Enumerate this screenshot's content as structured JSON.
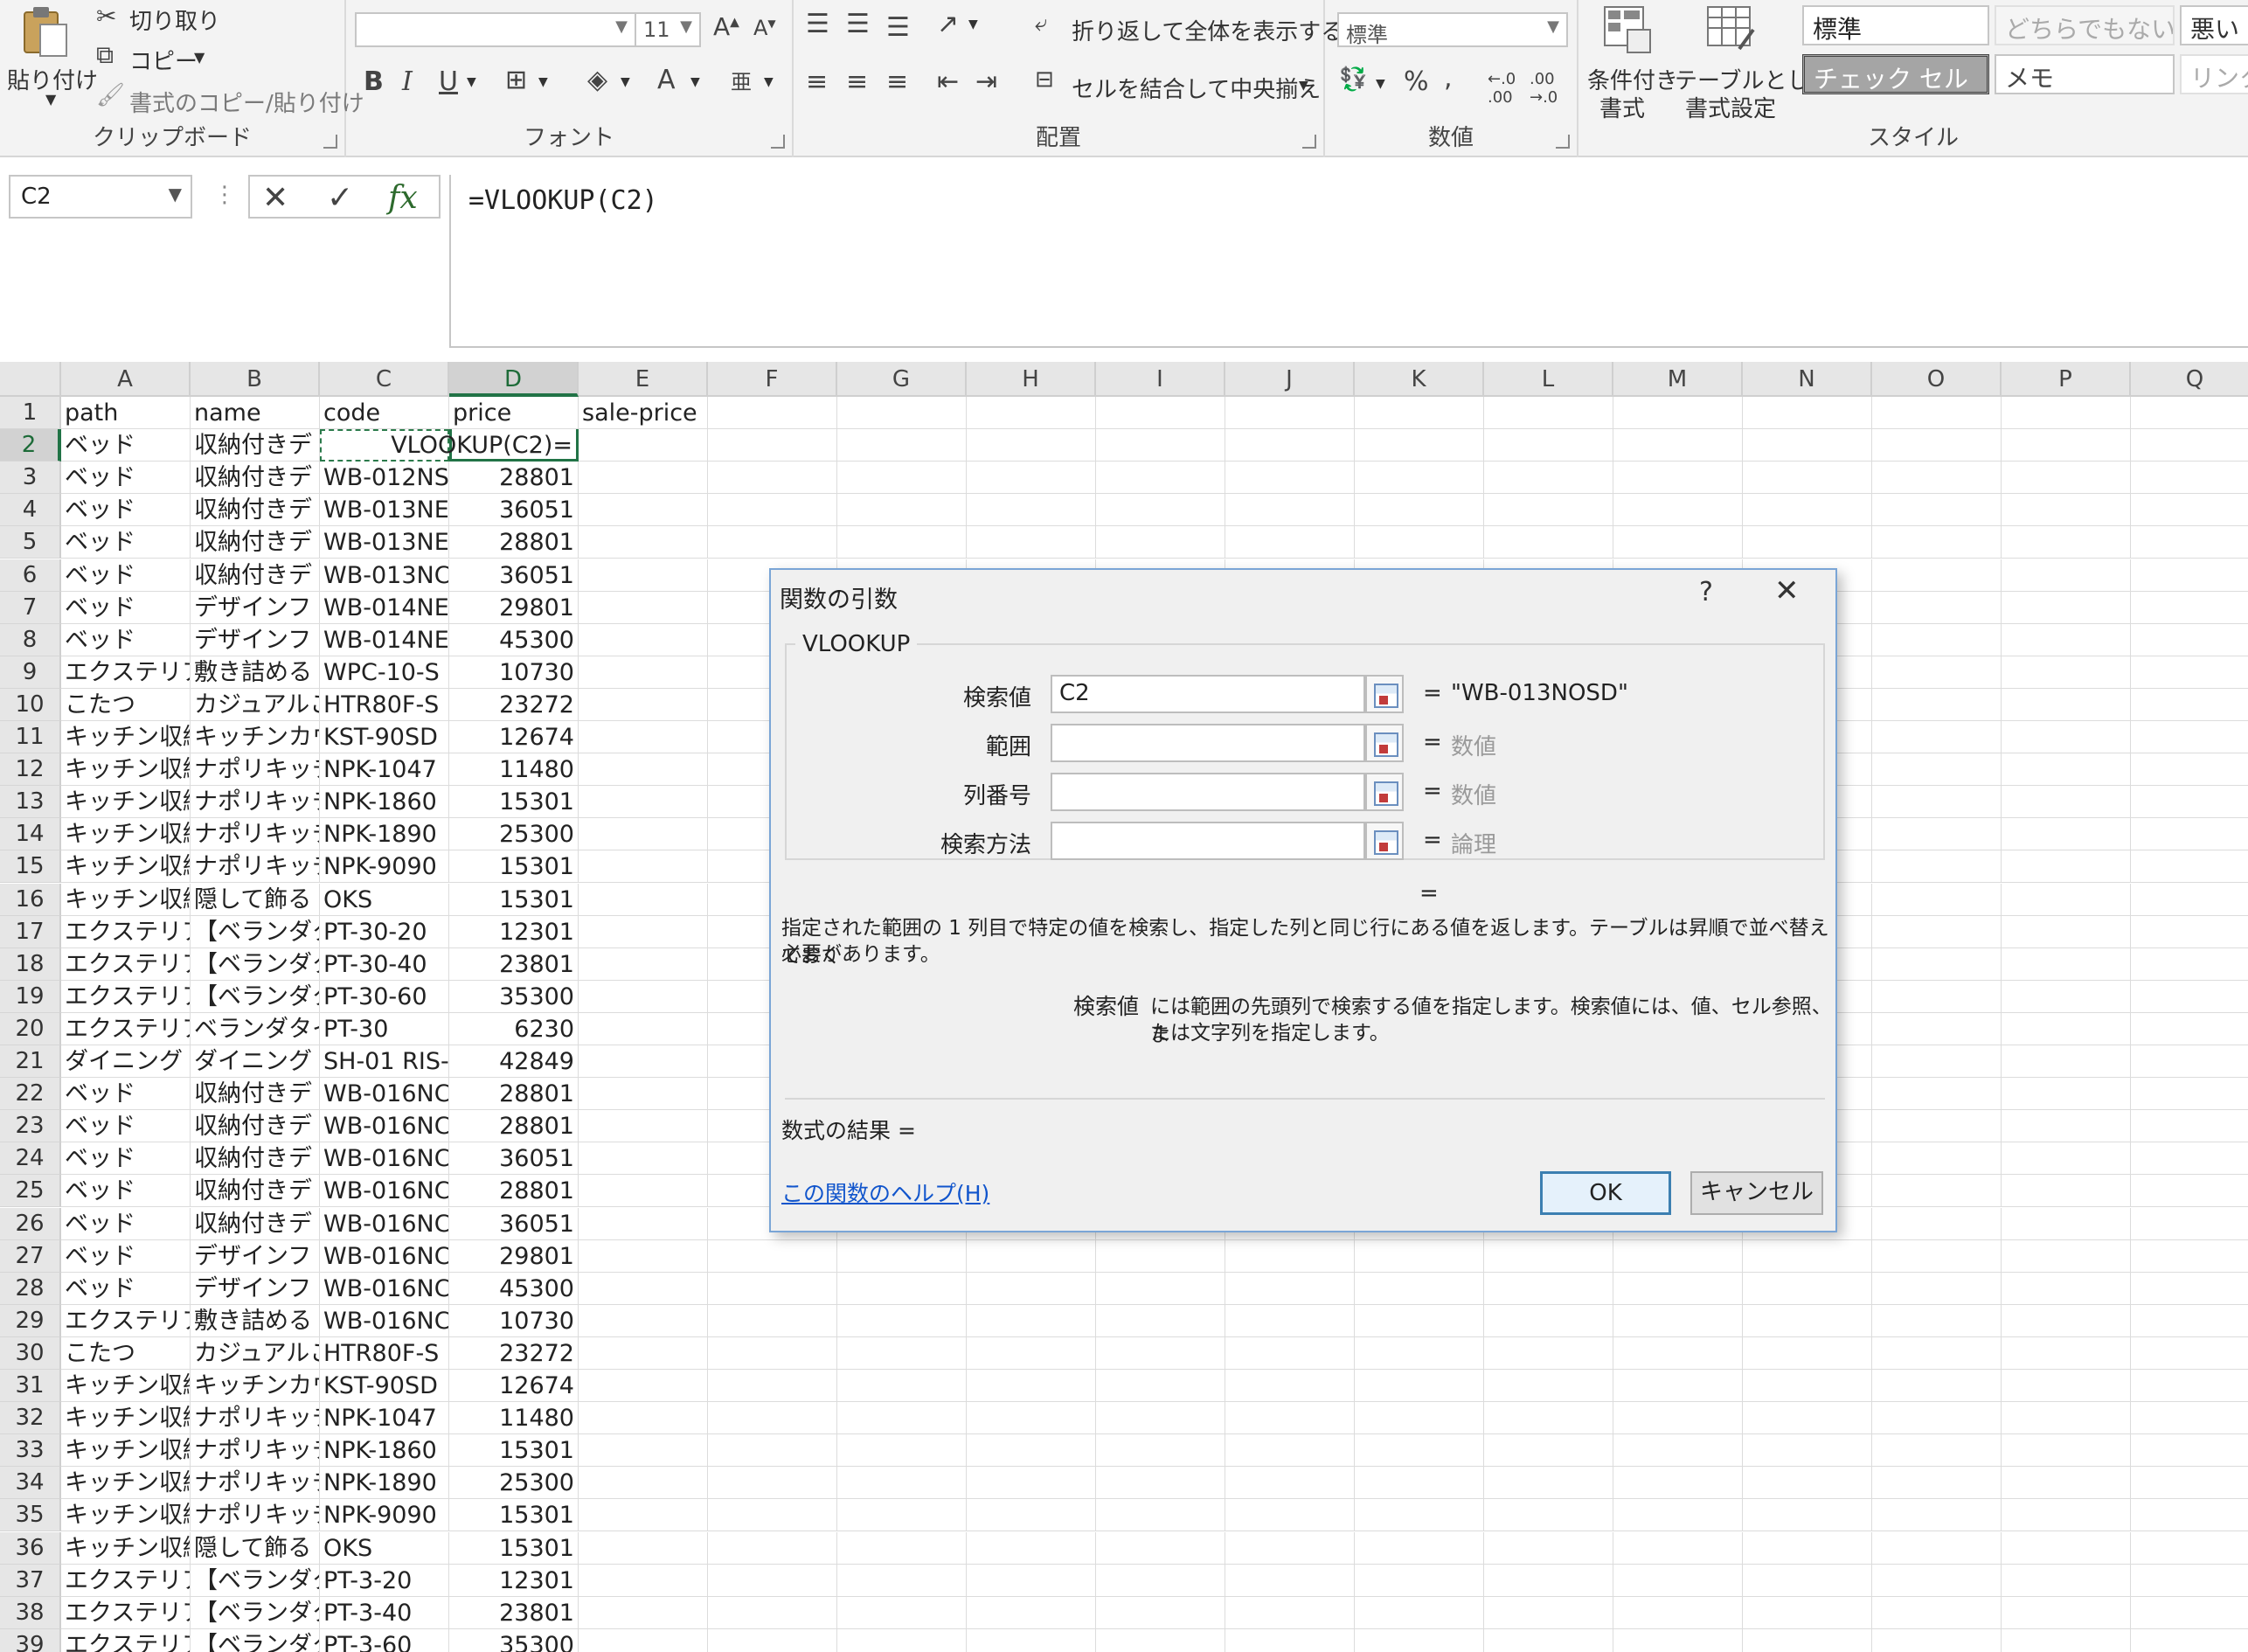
{
  "ribbon": {
    "clipboard": {
      "paste": "貼り付け",
      "cut": "切り取り",
      "copy": "コピー",
      "format_painter": "書式のコピー/貼り付け",
      "label": "クリップボード"
    },
    "font": {
      "font_name": "",
      "font_size": "11",
      "bold": "B",
      "italic": "I",
      "underline": "U",
      "font_color": "A",
      "label": "フォント"
    },
    "alignment": {
      "wrap_text": "折り返して全体を表示する",
      "merge_center": "セルを結合して中央揃え",
      "label": "配置"
    },
    "number": {
      "format": "標準",
      "percent": "%",
      "comma": ",",
      "label": "数値"
    },
    "styles": {
      "conditional_format": [
        "条件付き",
        "書式"
      ],
      "format_as_table": [
        "テーブルとして",
        "書式設定"
      ],
      "style_normal": "標準",
      "style_neutral": "どちらでもない",
      "style_bad": "悪い",
      "style_check": "チェック セル",
      "style_memo": "メモ",
      "style_link": "リンク",
      "label": "スタイル"
    }
  },
  "formula_bar": {
    "name_box": "C2",
    "fx": "fx",
    "formula": "=VLOOKUP(C2)"
  },
  "grid": {
    "columns": [
      "A",
      "B",
      "C",
      "D",
      "E",
      "F",
      "G",
      "H",
      "I",
      "J",
      "K",
      "L",
      "M",
      "N",
      "O",
      "P",
      "Q"
    ],
    "header_row": [
      "path",
      "name",
      "code",
      "price",
      "sale-price"
    ],
    "active_cell_text": "=VLOOKUP(C2)",
    "rows": [
      {
        "n": "2",
        "a": "ベッド",
        "b": "収納付きデ",
        "c": "",
        "d": ""
      },
      {
        "n": "3",
        "a": "ベッド",
        "b": "収納付きデ",
        "c": "WB-012NS",
        "d": "28801"
      },
      {
        "n": "4",
        "a": "ベッド",
        "b": "収納付きデ",
        "c": "WB-013NE",
        "d": "36051"
      },
      {
        "n": "5",
        "a": "ベッド",
        "b": "収納付きデ",
        "c": "WB-013NE",
        "d": "28801"
      },
      {
        "n": "6",
        "a": "ベッド",
        "b": "収納付きデ",
        "c": "WB-013NC",
        "d": "36051"
      },
      {
        "n": "7",
        "a": "ベッド",
        "b": "デザインフ",
        "c": "WB-014NE",
        "d": "29801"
      },
      {
        "n": "8",
        "a": "ベッド",
        "b": "デザインフ",
        "c": "WB-014NE",
        "d": "45300"
      },
      {
        "n": "9",
        "a": "エクステリア",
        "b": "敷き詰める",
        "c": "WPC-10-S",
        "d": "10730"
      },
      {
        "n": "10",
        "a": "こたつ",
        "b": "カジュアルこ",
        "c": "HTR80F-S",
        "d": "23272"
      },
      {
        "n": "11",
        "a": "キッチン収納",
        "b": "キッチンカウ",
        "c": "KST-90SD",
        "d": "12674"
      },
      {
        "n": "12",
        "a": "キッチン収納",
        "b": "ナポリキッチ",
        "c": "NPK-1047",
        "d": "11480"
      },
      {
        "n": "13",
        "a": "キッチン収納",
        "b": "ナポリキッチ",
        "c": "NPK-1860",
        "d": "15301"
      },
      {
        "n": "14",
        "a": "キッチン収納",
        "b": "ナポリキッチ",
        "c": "NPK-1890",
        "d": "25300"
      },
      {
        "n": "15",
        "a": "キッチン収納",
        "b": "ナポリキッチ",
        "c": "NPK-9090",
        "d": "15301"
      },
      {
        "n": "16",
        "a": "キッチン収納",
        "b": "隠して飾る",
        "c": "OKS",
        "d": "15301"
      },
      {
        "n": "17",
        "a": "エクステリア",
        "b": "【ベランダタ",
        "c": "PT-30-20",
        "d": "12301"
      },
      {
        "n": "18",
        "a": "エクステリア",
        "b": "【ベランダタ",
        "c": "PT-30-40",
        "d": "23801"
      },
      {
        "n": "19",
        "a": "エクステリア",
        "b": "【ベランダタ",
        "c": "PT-30-60",
        "d": "35300"
      },
      {
        "n": "20",
        "a": "エクステリア",
        "b": "ベランダタイ",
        "c": "PT-30",
        "d": "6230"
      },
      {
        "n": "21",
        "a": "ダイニング",
        "b": "ダイニング",
        "c": "SH-01 RIS-",
        "d": "42849"
      },
      {
        "n": "22",
        "a": "ベッド",
        "b": "収納付きデ",
        "c": "WB-016NC",
        "d": "28801"
      },
      {
        "n": "23",
        "a": "ベッド",
        "b": "収納付きデ",
        "c": "WB-016NC",
        "d": "28801"
      },
      {
        "n": "24",
        "a": "ベッド",
        "b": "収納付きデ",
        "c": "WB-016NC",
        "d": "36051"
      },
      {
        "n": "25",
        "a": "ベッド",
        "b": "収納付きデ",
        "c": "WB-016NC",
        "d": "28801"
      },
      {
        "n": "26",
        "a": "ベッド",
        "b": "収納付きデ",
        "c": "WB-016NC",
        "d": "36051"
      },
      {
        "n": "27",
        "a": "ベッド",
        "b": "デザインフ",
        "c": "WB-016NC",
        "d": "29801"
      },
      {
        "n": "28",
        "a": "ベッド",
        "b": "デザインフ",
        "c": "WB-016NC",
        "d": "45300"
      },
      {
        "n": "29",
        "a": "エクステリア",
        "b": "敷き詰める",
        "c": "WB-016NC",
        "d": "10730"
      },
      {
        "n": "30",
        "a": "こたつ",
        "b": "カジュアルこ",
        "c": "HTR80F-S",
        "d": "23272"
      },
      {
        "n": "31",
        "a": "キッチン収納",
        "b": "キッチンカウ",
        "c": "KST-90SD",
        "d": "12674"
      },
      {
        "n": "32",
        "a": "キッチン収納",
        "b": "ナポリキッチ",
        "c": "NPK-1047",
        "d": "11480"
      },
      {
        "n": "33",
        "a": "キッチン収納",
        "b": "ナポリキッチ",
        "c": "NPK-1860",
        "d": "15301"
      },
      {
        "n": "34",
        "a": "キッチン収納",
        "b": "ナポリキッチ",
        "c": "NPK-1890",
        "d": "25300"
      },
      {
        "n": "35",
        "a": "キッチン収納",
        "b": "ナポリキッチ",
        "c": "NPK-9090",
        "d": "15301"
      },
      {
        "n": "36",
        "a": "キッチン収納",
        "b": "隠して飾る",
        "c": "OKS",
        "d": "15301"
      },
      {
        "n": "37",
        "a": "エクステリア",
        "b": "【ベランダタ",
        "c": "PT-3-20",
        "d": "12301"
      },
      {
        "n": "38",
        "a": "エクステリア",
        "b": "【ベランダタ",
        "c": "PT-3-40",
        "d": "23801"
      },
      {
        "n": "39",
        "a": "エクステリア",
        "b": "【ベランダタ",
        "c": "PT-3-60",
        "d": "35300"
      }
    ]
  },
  "dialog": {
    "title": "関数の引数",
    "help": "?",
    "close": "✕",
    "function_name": "VLOOKUP",
    "args": [
      {
        "label": "検索値",
        "value": "C2",
        "result": "\"WB-013NOSD\"",
        "result_gray": false
      },
      {
        "label": "範囲",
        "value": "",
        "result": "数値",
        "result_gray": true
      },
      {
        "label": "列番号",
        "value": "",
        "result": "数値",
        "result_gray": true
      },
      {
        "label": "検索方法",
        "value": "",
        "result": "論理",
        "result_gray": true
      }
    ],
    "eq": "=",
    "description": [
      "指定された範囲の 1 列目で特定の値を検索し、指定した列と同じ行にある値を返します。テーブルは昇順で並べ替えておく",
      "必要があります。"
    ],
    "arg_name": "検索値",
    "arg_description": [
      "には範囲の先頭列で検索する値を指定します。検索値には、値、セル参照、ま",
      "たは文字列を指定します。"
    ],
    "result_label": "数式の結果 =",
    "help_link": "この関数のヘルプ(H)",
    "ok": "OK",
    "cancel": "キャンセル"
  }
}
